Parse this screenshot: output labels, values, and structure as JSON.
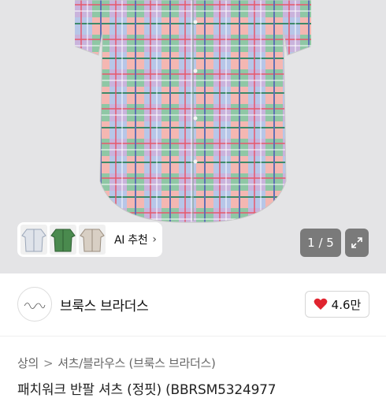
{
  "gallery": {
    "ai_recommend_label": "AI 추천",
    "chevron": "›",
    "counter": "1 / 5",
    "expand_icon": "expand-icon"
  },
  "brand": {
    "name": "브룩스 브라더스",
    "like_count": "4.6만",
    "heart_color": "#e0242f"
  },
  "breadcrumb": {
    "items": [
      "상의",
      "셔츠/블라우스",
      "(브룩스 브라더스)"
    ],
    "separator": ">"
  },
  "product": {
    "title_partial": "패치워크 반팔 셔츠 (정핏) (BBRSM5324977"
  }
}
